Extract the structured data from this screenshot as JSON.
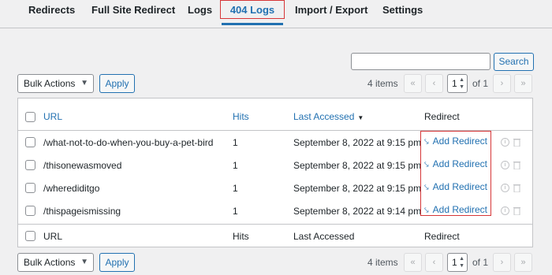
{
  "tabs": [
    {
      "label": "Redirects"
    },
    {
      "label": "Full Site Redirect"
    },
    {
      "label": "Logs"
    },
    {
      "label": "404 Logs"
    },
    {
      "label": "Import / Export"
    },
    {
      "label": "Settings"
    }
  ],
  "active_tab": "404 Logs",
  "search": {
    "button_label": "Search",
    "value": ""
  },
  "toolbar": {
    "bulk_actions": "Bulk Actions",
    "apply": "Apply",
    "items": "4 items",
    "page": "1",
    "of_pages": "of 1",
    "first": "«",
    "prev": "‹",
    "next": "›",
    "last": "»"
  },
  "table": {
    "columns": {
      "url": "URL",
      "hits": "Hits",
      "last_accessed": "Last Accessed",
      "redirect": "Redirect"
    },
    "sort_indicator": "▼",
    "rows": [
      {
        "url": "/what-not-to-do-when-you-buy-a-pet-bird",
        "hits": "1",
        "last_accessed": "September 8, 2022 at 9:15 pm",
        "action": "Add Redirect"
      },
      {
        "url": "/thisonewasmoved",
        "hits": "1",
        "last_accessed": "September 8, 2022 at 9:15 pm",
        "action": "Add Redirect"
      },
      {
        "url": "/wherediditgo",
        "hits": "1",
        "last_accessed": "September 8, 2022 at 9:15 pm",
        "action": "Add Redirect"
      },
      {
        "url": "/thispageismissing",
        "hits": "1",
        "last_accessed": "September 8, 2022 at 9:14 pm",
        "action": "Add Redirect"
      }
    ]
  },
  "colors": {
    "accent": "#2271b1",
    "highlight": "#d63638"
  }
}
